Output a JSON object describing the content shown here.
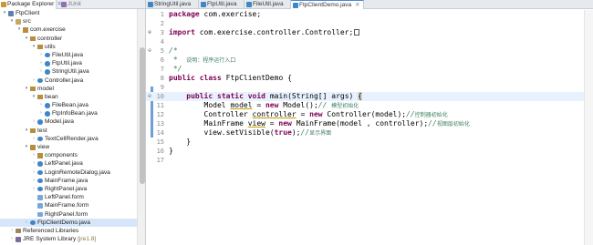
{
  "explorer": {
    "tabs": [
      {
        "label": "Package Explorer",
        "close": "✕"
      },
      {
        "label": "JUnit"
      }
    ],
    "tree": [
      {
        "depth": 0,
        "arrow": "▾",
        "icon": "project",
        "label": "FtpClient"
      },
      {
        "depth": 1,
        "arrow": "▾",
        "icon": "folder",
        "label": "src"
      },
      {
        "depth": 2,
        "arrow": "▾",
        "icon": "package",
        "label": "com.exercise"
      },
      {
        "depth": 3,
        "arrow": "▾",
        "icon": "package",
        "label": "controller"
      },
      {
        "depth": 4,
        "arrow": "▾",
        "icon": "package",
        "label": "utils"
      },
      {
        "depth": 5,
        "arrow": "›",
        "icon": "java",
        "label": "FileUtil.java"
      },
      {
        "depth": 5,
        "arrow": "›",
        "icon": "java",
        "label": "FtpUtil.java"
      },
      {
        "depth": 5,
        "arrow": "›",
        "icon": "java",
        "label": "StringUtil.java"
      },
      {
        "depth": 4,
        "arrow": "›",
        "icon": "java",
        "label": "Controller.java"
      },
      {
        "depth": 3,
        "arrow": "▾",
        "icon": "package",
        "label": "model"
      },
      {
        "depth": 4,
        "arrow": "▾",
        "icon": "package",
        "label": "bean"
      },
      {
        "depth": 5,
        "arrow": "›",
        "icon": "java",
        "label": "FileBean.java"
      },
      {
        "depth": 5,
        "arrow": "›",
        "icon": "java",
        "label": "FtpInfoBean.java"
      },
      {
        "depth": 4,
        "arrow": "›",
        "icon": "java",
        "label": "Model.java"
      },
      {
        "depth": 3,
        "arrow": "▾",
        "icon": "package",
        "label": "test"
      },
      {
        "depth": 4,
        "arrow": "›",
        "icon": "java",
        "label": "TextCellRender.java"
      },
      {
        "depth": 3,
        "arrow": "▾",
        "icon": "package",
        "label": "view"
      },
      {
        "depth": 4,
        "arrow": "›",
        "icon": "package",
        "label": "components"
      },
      {
        "depth": 4,
        "arrow": "›",
        "icon": "java",
        "label": "LeftPanel.java"
      },
      {
        "depth": 4,
        "arrow": "›",
        "icon": "java",
        "label": "LoginRemoteDialog.java"
      },
      {
        "depth": 4,
        "arrow": "›",
        "icon": "java",
        "label": "MainFrame.java"
      },
      {
        "depth": 4,
        "arrow": "›",
        "icon": "java",
        "label": "RightPanel.java"
      },
      {
        "depth": 4,
        "arrow": "",
        "icon": "form",
        "label": "LeftPanel.form"
      },
      {
        "depth": 4,
        "arrow": "",
        "icon": "form",
        "label": "MainFrame.form"
      },
      {
        "depth": 4,
        "arrow": "",
        "icon": "form",
        "label": "RightPanel.form"
      },
      {
        "depth": 3,
        "arrow": "›",
        "icon": "java",
        "label": "FtpClientDemo.java",
        "selected": true
      },
      {
        "depth": 1,
        "arrow": "›",
        "icon": "lib",
        "label": "Referenced Libraries"
      },
      {
        "depth": 1,
        "arrow": "›",
        "icon": "jre",
        "label": "JRE System Library",
        "suffix": " [jre1.8]"
      }
    ]
  },
  "editor": {
    "tabs": [
      {
        "label": "StringUtil.java"
      },
      {
        "label": "FtpUtil.java"
      },
      {
        "label": "FileUtil.java"
      },
      {
        "label": "FtpClientDemo.java",
        "active": true,
        "close": "✕"
      }
    ],
    "lines": [
      {
        "n": "1",
        "fold": "",
        "html": "<span class=\"kw\">package</span> com.exercise;"
      },
      {
        "n": "2",
        "fold": "",
        "html": ""
      },
      {
        "n": "3",
        "fold": "+",
        "html": "<span class=\"kw\">import</span> com.exercise.controller.Controller;<span class=\"tail-box\"></span>"
      },
      {
        "n": "4",
        "fold": "",
        "html": ""
      },
      {
        "n": "5",
        "fold": "-",
        "html": "<span class=\"cm\">/*</span>"
      },
      {
        "n": "6",
        "fold": "",
        "html": "<span class=\"cm\"> *  <span class=\"cjk\">说明：程序运行入口</span></span>"
      },
      {
        "n": "7",
        "fold": "",
        "html": "<span class=\"cm\"> */</span>"
      },
      {
        "n": "8",
        "fold": "",
        "html": "<span class=\"kw\">public</span> <span class=\"kw\">class</span> FtpClientDemo {"
      },
      {
        "n": "9",
        "fold": "",
        "html": ""
      },
      {
        "n": "10",
        "fold": "-",
        "current": true,
        "html": "    <span class=\"kw\">public</span> <span class=\"kw\">static</span> <span class=\"kw\">void</span> main(String[] args) <span class=\"sel\">{</span>"
      },
      {
        "n": "11",
        "fold": "",
        "html": "        Model <span class=\"unuse\">model</span> = <span class=\"kw\">new</span> Model();<span class=\"cm\">// <span class=\"cjk\">模型初始化</span></span>"
      },
      {
        "n": "12",
        "fold": "",
        "html": "        Controller <span class=\"unuse\">controller</span> = <span class=\"kw\">new</span> Controller(model);<span class=\"cm\">//<span class=\"cjk\">控制器初始化</span></span>"
      },
      {
        "n": "13",
        "fold": "",
        "html": "        MainFrame <span class=\"unuse\">view</span> = <span class=\"kw\">new</span> MainFrame(model , controller);<span class=\"cm\">//<span class=\"cjk\">视图层初始化</span></span>"
      },
      {
        "n": "14",
        "fold": "",
        "html": "        view.setVisible(<span class=\"kw\">true</span>);<span class=\"cm\">//<span class=\"cjk\">显示界面</span></span>"
      },
      {
        "n": "15",
        "fold": "",
        "html": "    }"
      },
      {
        "n": "16",
        "fold": "",
        "html": "}"
      },
      {
        "n": "17",
        "fold": "",
        "html": ""
      }
    ]
  }
}
